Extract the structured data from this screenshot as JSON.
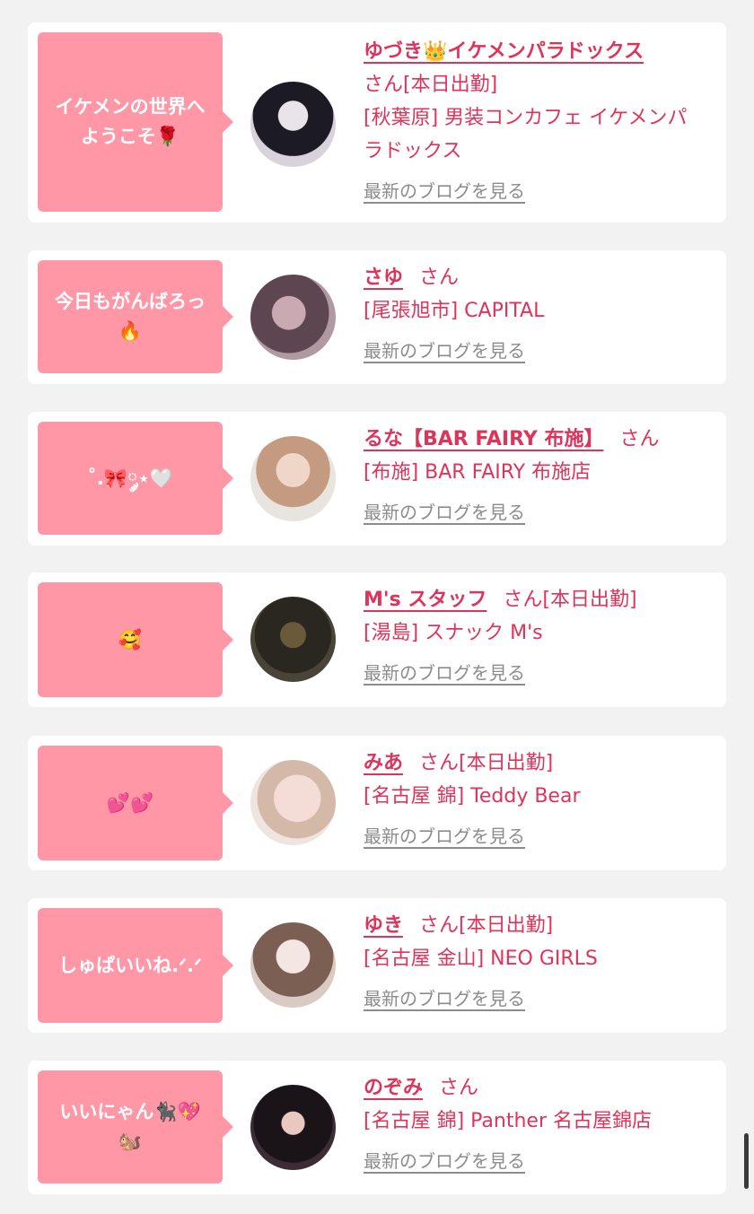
{
  "blog_link_label": "最新のブログを見る",
  "colors": {
    "background": "#f2f2f2",
    "bubble": "#ff97a6",
    "accent_text": "#e0335a",
    "link_gray": "#8c8c8c"
  },
  "entries": [
    {
      "message": "イケメンの世界へ\nようこそ🌹",
      "name": "ゆづき👑イケメンパラドックス",
      "suffix": "さん[本日出勤]",
      "shop": "[秋葉原] 男装コンカフェ イケメンパラドックス",
      "avatar_icon": "avatar-photo-icon"
    },
    {
      "message": "今日もがんばろっ\n🔥",
      "name": "さゆ",
      "suffix": "さん",
      "shop": "[尾張旭市] CAPITAL",
      "avatar_icon": "avatar-photo-icon"
    },
    {
      "message": "˚.🎀༘⋆🤍",
      "name": "るな【BAR FAIRY 布施】",
      "suffix": "さん",
      "shop": "[布施] BAR FAIRY 布施店",
      "avatar_icon": "avatar-photo-icon"
    },
    {
      "message": "🥰",
      "name": "M's スタッフ",
      "suffix": "さん[本日出勤]",
      "shop": "[湯島] スナック M's",
      "avatar_icon": "avatar-photo-icon"
    },
    {
      "message": "💕💕",
      "name": "みあ",
      "suffix": "さん[本日出勤]",
      "shop": "[名古屋 錦] Teddy Bear",
      "avatar_icon": "avatar-photo-icon"
    },
    {
      "message": "しゅぱいいね.ᐟ.ᐟ",
      "name": "ゆき",
      "suffix": "さん[本日出勤]",
      "shop": "[名古屋 金山] NEO GIRLS",
      "avatar_icon": "avatar-photo-icon"
    },
    {
      "message": "いいにゃん🐈‍⬛💖\n🐿️",
      "name": "のぞみ",
      "suffix": "さん",
      "shop": "[名古屋 錦] Panther 名古屋錦店",
      "avatar_icon": "avatar-photo-icon"
    }
  ]
}
